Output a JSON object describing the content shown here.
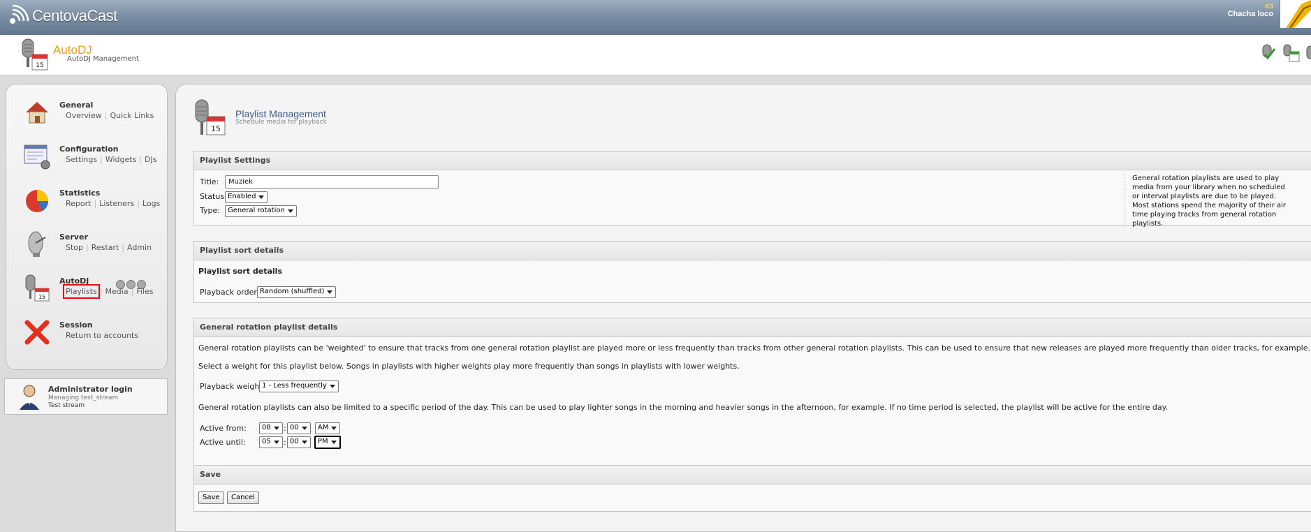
{
  "topbar": {
    "logo_text": "CentovaCast",
    "user_small": "K3",
    "user_name": "Chacha loco"
  },
  "header": {
    "title": "AutoDJ",
    "subtitle": "AutoDJ Management"
  },
  "sidebar": {
    "general": {
      "label": "General",
      "links": [
        "Overview",
        "Quick Links"
      ]
    },
    "configuration": {
      "label": "Configuration",
      "links": [
        "Settings",
        "Widgets",
        "DJs"
      ]
    },
    "statistics": {
      "label": "Statistics",
      "links": [
        "Report",
        "Listeners",
        "Logs"
      ]
    },
    "server": {
      "label": "Server",
      "links": [
        "Stop",
        "Restart",
        "Admin"
      ]
    },
    "autodj": {
      "label": "AutoDJ",
      "links": [
        "Playlists",
        "Media",
        "Files"
      ]
    },
    "session": {
      "label": "Session",
      "links": [
        "Return to accounts"
      ]
    }
  },
  "admin": {
    "title": "Administrator login",
    "managing": "Managing test_stream",
    "stream": "Test stream"
  },
  "page": {
    "title": "Playlist Management",
    "subtitle": "Schedule media for playback"
  },
  "settings": {
    "heading": "Playlist Settings",
    "title_label": "Title:",
    "title_value": "Muziek",
    "status_label": "Status:",
    "status_value": "Enabled",
    "type_label": "Type:",
    "type_value": "General rotation",
    "info": "General rotation playlists are used to play media from your library when no scheduled or interval playlists are due to be played. Most stations spend the majority of their air time playing tracks from general rotation playlists."
  },
  "sort": {
    "heading": "Playlist sort details",
    "subheading": "Playlist sort details",
    "order_label": "Playback order:",
    "order_value": "Random (shuffled)"
  },
  "rotation": {
    "heading": "General rotation playlist details",
    "para1": "General rotation playlists can be 'weighted' to ensure that tracks from one general rotation playlist are played more or less frequently than tracks from other general rotation playlists. This can be used to ensure that new releases are played more frequently than older tracks, for example.",
    "para2": "Select a weight for this playlist below. Songs in playlists with higher weights play more frequently than songs in playlists with lower weights.",
    "weight_label": "Playback weight:",
    "weight_value": "1 - Less frequently",
    "para3": "General rotation playlists can also be limited to a specific period of the day. This can be used to play lighter songs in the morning and heavier songs in the afternoon, for example. If no time period is selected, the playlist will be active for the entire day.",
    "from_label": "Active from:",
    "from_hour": "08",
    "from_min": "00",
    "from_ampm": "AM",
    "until_label": "Active until:",
    "until_hour": "05",
    "until_min": "00",
    "until_ampm": "PM",
    "colon": ":"
  },
  "save": {
    "heading": "Save",
    "save_label": "Save",
    "cancel_label": "Cancel"
  },
  "colors": {
    "accent": "#f0a000",
    "title_blue": "#3c5a8a",
    "highlight": "#e01010"
  }
}
